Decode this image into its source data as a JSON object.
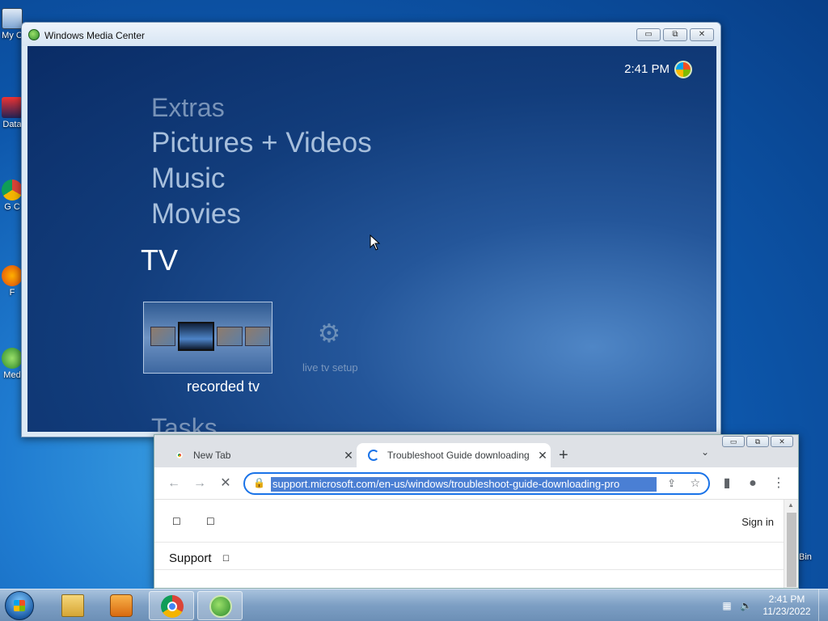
{
  "desktop": {
    "icons": [
      {
        "label": "My C"
      },
      {
        "label": "Data"
      },
      {
        "label": "G C"
      },
      {
        "label": "F"
      },
      {
        "label": "Med"
      }
    ],
    "recycle_bin_label": "Bin"
  },
  "wmc": {
    "title": "Windows Media Center",
    "clock": "2:41 PM",
    "menu": [
      "Extras",
      "Pictures + Videos",
      "Music",
      "Movies"
    ],
    "current_section": "TV",
    "tiles": {
      "recorded": "recorded tv",
      "live_setup": "live tv setup"
    },
    "next_section": "Tasks",
    "window_buttons": {
      "minimize": "▭",
      "maximize": "⧉",
      "close": "✕"
    }
  },
  "chrome": {
    "tabs": [
      {
        "label": "New Tab",
        "close": "✕"
      },
      {
        "label": "Troubleshoot Guide downloading",
        "close": "✕"
      }
    ],
    "new_tab": "+",
    "tab_list": "⌄",
    "nav": {
      "back": "←",
      "forward": "→",
      "stop": "✕"
    },
    "address": "support.microsoft.com/en-us/windows/troubleshoot-guide-downloading-pro",
    "page": {
      "signin": "Sign in",
      "support": "Support",
      "glyph_box": "☐"
    },
    "window_buttons": {
      "minimize": "▭",
      "maximize": "⧉",
      "close": "✕"
    }
  },
  "taskbar": {
    "clock_time": "2:41 PM",
    "clock_date": "11/23/2022"
  }
}
